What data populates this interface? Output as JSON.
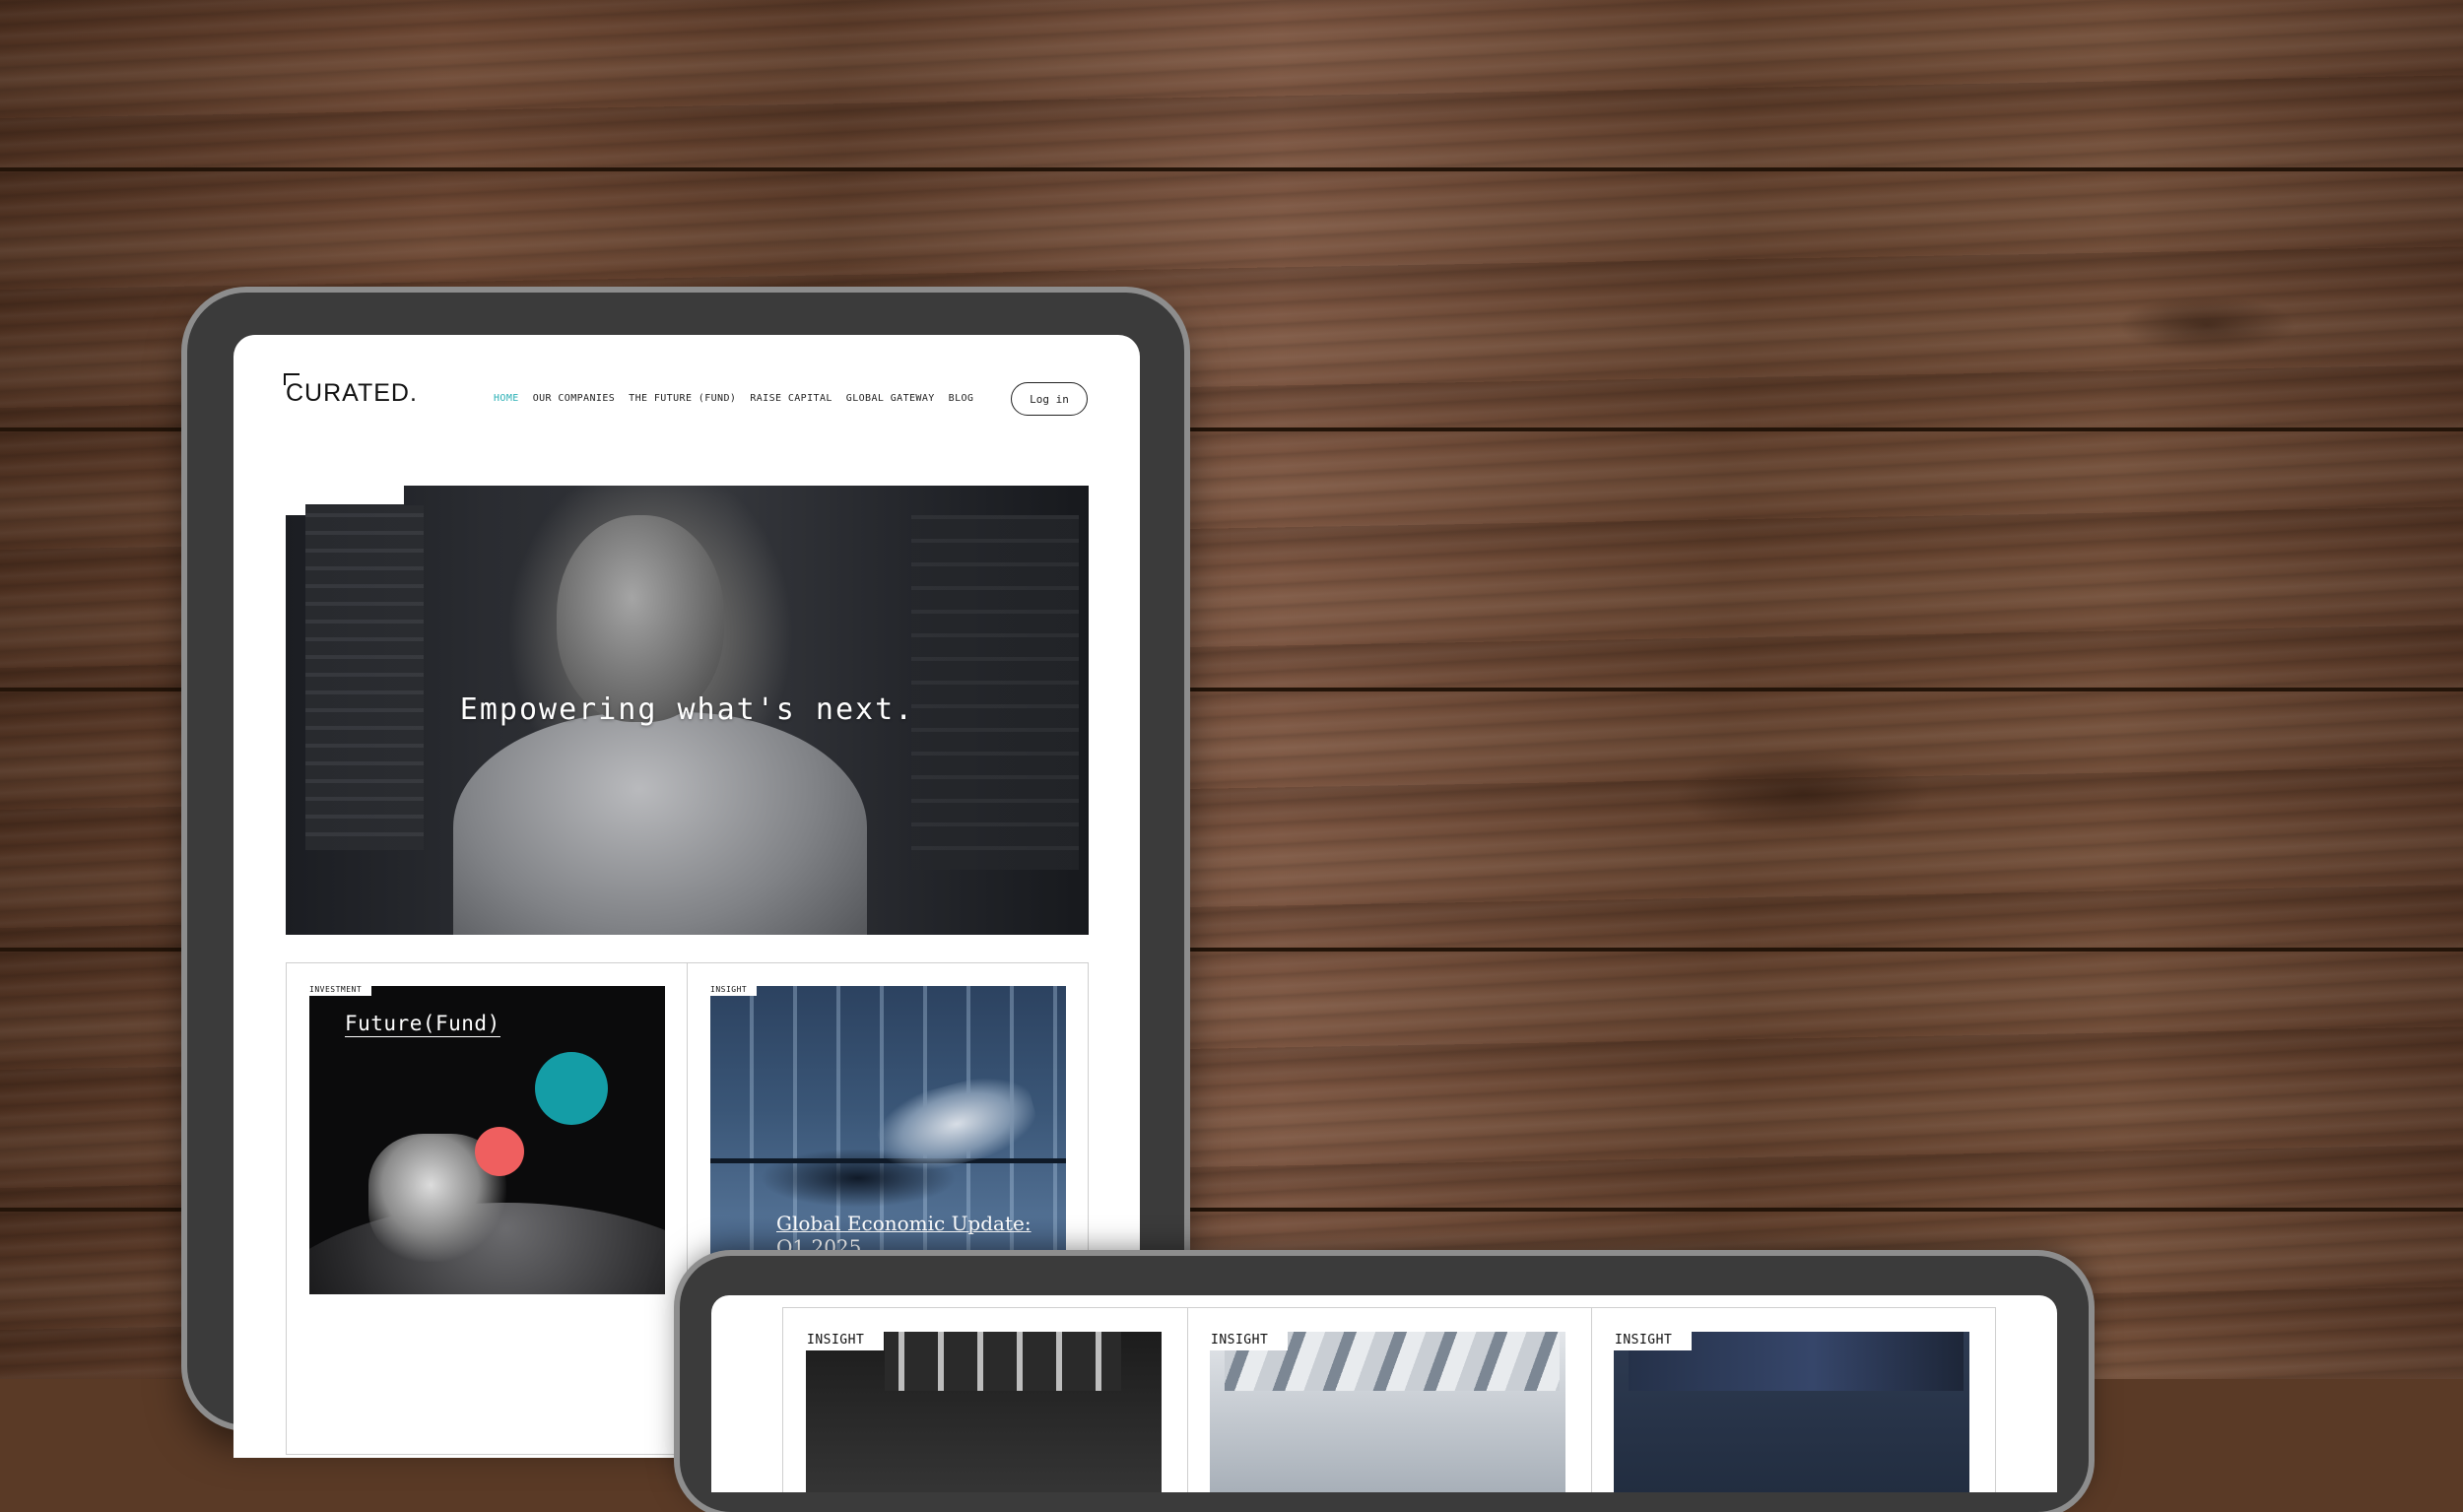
{
  "site": {
    "logo": "CURATED.",
    "nav": {
      "items": [
        "HOME",
        "OUR COMPANIES",
        "THE FUTURE (FUND)",
        "RAISE CAPITAL",
        "GLOBAL GATEWAY",
        "BLOG"
      ],
      "active": "HOME",
      "login_label": "Log in"
    },
    "hero": {
      "headline": "Empowering what's next."
    },
    "cards": [
      {
        "tag": "INVESTMENT",
        "title": "Future(Fund)"
      },
      {
        "tag": "INSIGHT",
        "title": "Global Economic Update: Q1 2025"
      }
    ],
    "second_device_cards": [
      {
        "tag": "INSIGHT"
      },
      {
        "tag": "INSIGHT"
      },
      {
        "tag": "INSIGHT"
      }
    ]
  },
  "colors": {
    "accent_teal": "#2bb0b5",
    "circle_teal": "#149da6",
    "circle_red": "#ef5f5f"
  }
}
